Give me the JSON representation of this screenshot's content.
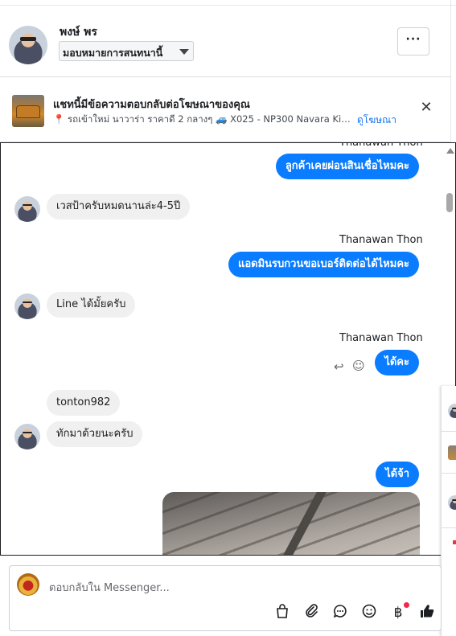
{
  "header": {
    "contact_name": "พงษ์ พร",
    "assign_label": "มอบหมายการสนทนานี้",
    "more_label": "···"
  },
  "ad": {
    "title": "แชทนี้มีข้อความตอบกลับต่อโฆษณาของคุณ",
    "description": "รถเข้าใหม่ นาวาร่า ราคาดี 2 กลางๆ 🚙 X025 - NP300 Navara King C...",
    "link_label": "ดูโฆษณา",
    "close_label": "✕"
  },
  "conversation": {
    "top_partial_sender": "Thanawan Thon",
    "messages": [
      {
        "text": "ลูกค้าเคยผ่อนสินเชื่อไหมคะ",
        "direction": "outgoing"
      },
      {
        "text": "เวสป้าครับหมดนานล่ะ4-5ปี",
        "direction": "incoming"
      },
      {
        "text": "Thanawan Thon",
        "direction": "sender"
      },
      {
        "text": "แอดมินรบกวนขอเบอร์ติดต่อได้ไหมคะ",
        "direction": "outgoing"
      },
      {
        "text": "Line ได้มั้ยครับ",
        "direction": "incoming"
      },
      {
        "text": "Thanawan Thon",
        "direction": "sender"
      },
      {
        "text": "ได้คะ",
        "direction": "outgoing"
      },
      {
        "text": "tonton982",
        "direction": "incoming"
      },
      {
        "text": "ทักมาด้วยนะครับ",
        "direction": "incoming"
      },
      {
        "text": "ได้จ้า",
        "direction": "outgoing"
      }
    ],
    "message_actions": {
      "reply_icon": "reply-icon",
      "react_icon": "smiley-icon"
    }
  },
  "composer": {
    "placeholder": "ตอบกลับใน Messenger...",
    "tools": [
      "bag-icon",
      "paperclip-icon",
      "chat-bubble-icon",
      "emoji-icon",
      "baht-icon",
      "thumbs-up-icon"
    ]
  },
  "colors": {
    "outgoing_bubble": "#0a7cff",
    "incoming_bubble": "#f0f0f0",
    "link": "#1877f2",
    "notification_dot": "#f02849"
  }
}
